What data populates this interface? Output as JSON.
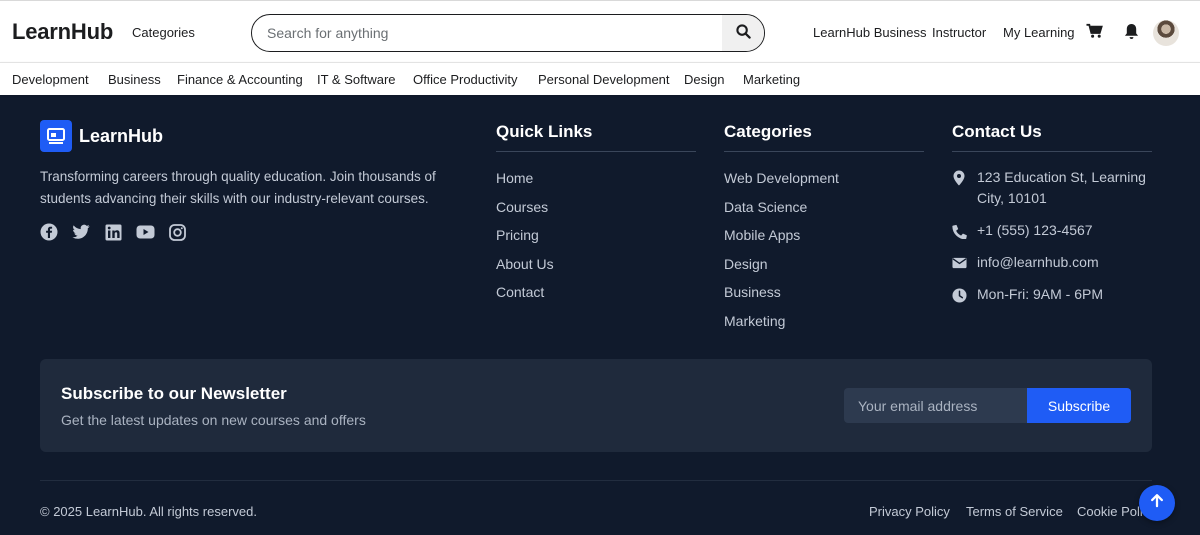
{
  "header": {
    "logo": "LearnHub",
    "categories_label": "Categories",
    "search_placeholder": "Search for anything",
    "links": {
      "business": "LearnHub Business",
      "instructor": "Instructor",
      "my_learning": "My Learning"
    },
    "icons": [
      "search-icon",
      "cart-icon",
      "bell-icon",
      "avatar"
    ]
  },
  "category_bar": [
    "Development",
    "Business",
    "Finance & Accounting",
    "IT & Software",
    "Office Productivity",
    "Personal Development",
    "Design",
    "Marketing"
  ],
  "footer": {
    "brand_name": "LearnHub",
    "description": "Transforming careers through quality education. Join thousands of students advancing their skills with our industry-relevant courses.",
    "socials": [
      "facebook-icon",
      "twitter-icon",
      "linkedin-icon",
      "youtube-icon",
      "instagram-icon"
    ],
    "quick_links": {
      "title": "Quick Links",
      "items": [
        "Home",
        "Courses",
        "Pricing",
        "About Us",
        "Contact"
      ]
    },
    "categories": {
      "title": "Categories",
      "items": [
        "Web Development",
        "Data Science",
        "Mobile Apps",
        "Design",
        "Business",
        "Marketing"
      ]
    },
    "contact": {
      "title": "Contact Us",
      "address_line1": "123 Education St, Learning",
      "address_line2": "City, 10101",
      "phone": "+1 (555) 123-4567",
      "email": "info@learnhub.com",
      "hours": "Mon-Fri: 9AM - 6PM"
    },
    "newsletter": {
      "title": "Subscribe to our Newsletter",
      "subtitle": "Get the latest updates on new courses and offers",
      "email_placeholder": "Your email address",
      "button_label": "Subscribe"
    },
    "copyright": "© 2025 LearnHub. All rights reserved.",
    "legal": {
      "privacy": "Privacy Policy",
      "terms": "Terms of Service",
      "cookie": "Cookie Policy"
    }
  },
  "colors": {
    "footer_bg": "#101a2c",
    "accent": "#1f5cf5",
    "newsletter_bg": "#1f2a3c"
  }
}
